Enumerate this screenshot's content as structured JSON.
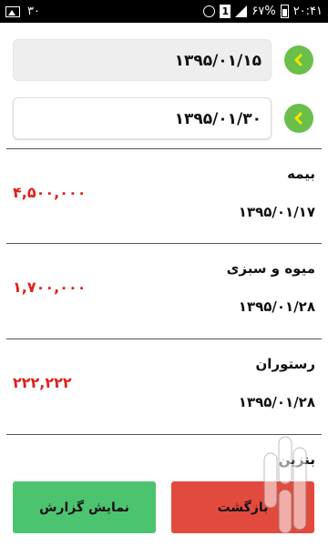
{
  "status_bar": {
    "notification_count": "۳۰",
    "time": "۲۰:۴۱",
    "battery_percent": "۶۷%",
    "sim_label": "1",
    "icons": [
      "image-icon",
      "alarm-icon",
      "sim-icon",
      "signal-icon",
      "battery-icon"
    ]
  },
  "date_range": {
    "from": "۱۳۹۵/۰۱/۱۵",
    "to": "۱۳۹۵/۰۱/۳۰"
  },
  "expenses": [
    {
      "title": "بیمه",
      "date": "۱۳۹۵/۰۱/۱۷",
      "amount": "۴,۵۰۰,۰۰۰"
    },
    {
      "title": "میوه و سبزی",
      "date": "۱۳۹۵/۰۱/۲۸",
      "amount": "۱,۷۰۰,۰۰۰"
    },
    {
      "title": "رستوران",
      "date": "۱۳۹۵/۰۱/۲۸",
      "amount": "۲۲۲,۲۲۲"
    },
    {
      "title": "بنزین",
      "date": "",
      "amount": ""
    }
  ],
  "buttons": {
    "report": "نمایش گزارش",
    "back": "بازگشت"
  },
  "colors": {
    "accent_green": "#6abf4b",
    "report_button": "#4cc46f",
    "back_button": "#e24a3e",
    "amount_red": "#e0201c",
    "status_bar": "#000000"
  }
}
